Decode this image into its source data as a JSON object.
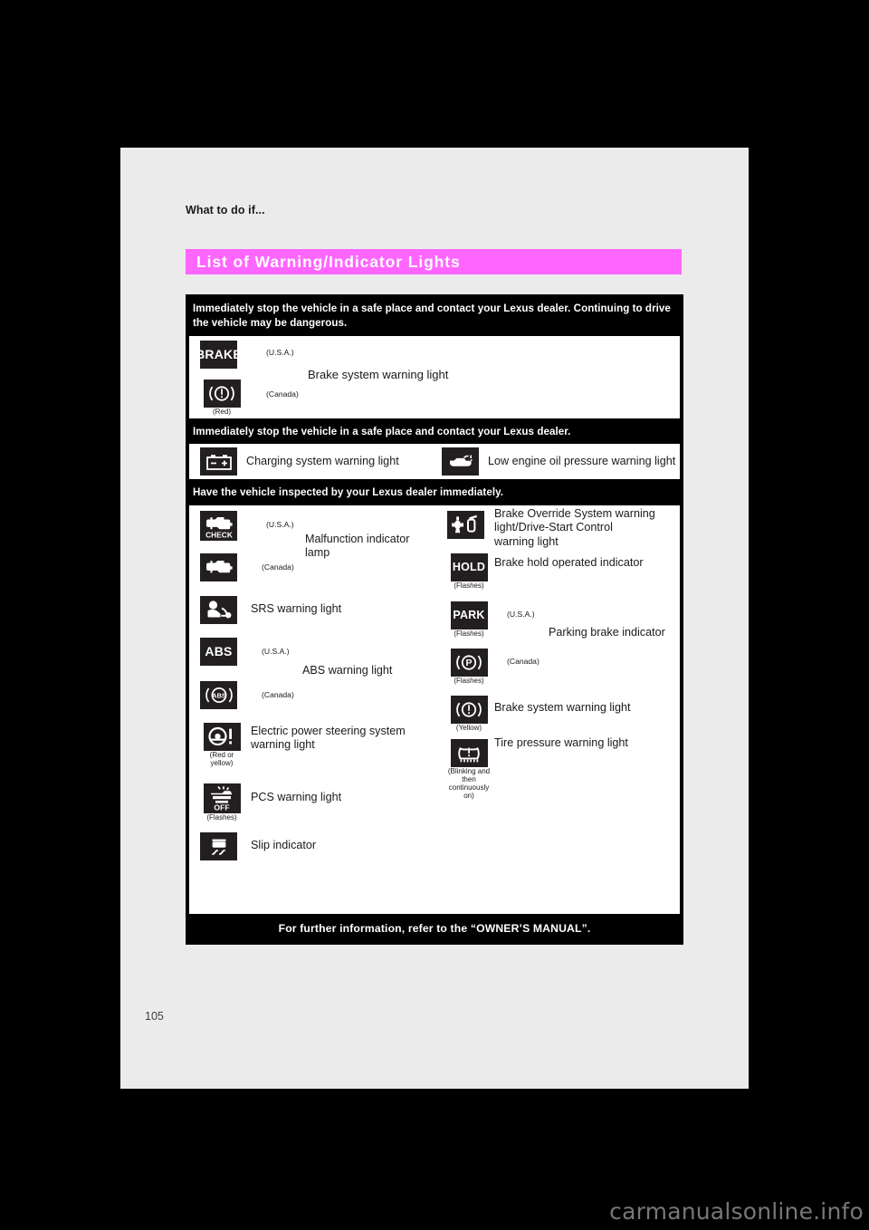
{
  "page": {
    "running_head": "What to do if...",
    "section_title": "List of Warning/Indicator Lights",
    "folio": "105",
    "watermark": "carmanualsonline.info",
    "accent_color": "#ff66ff",
    "band_color": "#000000",
    "sheet_color": "#ebebeb",
    "icon_tile_color": "#231f20"
  },
  "table": {
    "sections": [
      {
        "heading": "Immediately stop the vehicle in a safe place and contact your Lexus dealer. Continuing to drive the vehicle may be dangerous.",
        "items": [
          {
            "name": "Brake system warning light",
            "variants": [
              {
                "icon": "brake-word-icon",
                "icon_text": "BRAKE",
                "region": "(U.S.A.)"
              },
              {
                "icon": "brake-circle-exclamation-icon",
                "icon_text": "",
                "region": "(Canada)",
                "note": "(Red)"
              }
            ]
          }
        ]
      },
      {
        "heading": "Immediately stop the vehicle in a safe place and contact your Lexus dealer.",
        "items": [
          {
            "name": "Charging system warning light",
            "icon": "battery-icon"
          },
          {
            "name": "Low engine oil pressure warning light",
            "icon": "oil-can-icon"
          }
        ]
      },
      {
        "heading": "Have the vehicle inspected by your Lexus dealer immediately.",
        "left_items": [
          {
            "name": "Malfunction indicator lamp",
            "variants": [
              {
                "icon": "engine-check-icon",
                "icon_text": "CHECK",
                "region": "(U.S.A.)"
              },
              {
                "icon": "engine-icon",
                "icon_text": "",
                "region": "(Canada)"
              }
            ]
          },
          {
            "name": "SRS warning light",
            "icon": "srs-airbag-icon"
          },
          {
            "name": "ABS warning light",
            "variants": [
              {
                "icon": "abs-word-icon",
                "icon_text": "ABS",
                "region": "(U.S.A.)"
              },
              {
                "icon": "abs-circle-icon",
                "icon_text": "ABS",
                "region": "(Canada)"
              }
            ]
          },
          {
            "name": "Electric power steering system warning light",
            "icon": "steering-wheel-exclamation-icon",
            "note": "(Red or yellow)"
          },
          {
            "name": "PCS warning light",
            "icon": "pcs-off-icon",
            "icon_text": "OFF",
            "note": "(Flashes)"
          },
          {
            "name": "Slip indicator",
            "icon": "slip-indicator-icon"
          }
        ],
        "right_items": [
          {
            "name": "Brake Override System warning light/Drive-Start Control warning light",
            "icon": "brake-override-pedal-icon"
          },
          {
            "name": "Brake hold operated indicator",
            "icon": "hold-word-icon",
            "icon_text": "HOLD",
            "note": "(Flashes)"
          },
          {
            "name": "Parking brake indicator",
            "variants": [
              {
                "icon": "park-word-icon",
                "icon_text": "PARK",
                "region": "(U.S.A.)",
                "note": "(Flashes)"
              },
              {
                "icon": "park-circle-p-icon",
                "icon_text": "P",
                "region": "(Canada)",
                "note": "(Flashes)"
              }
            ]
          },
          {
            "name": "Brake system warning light",
            "icon": "brake-circle-exclamation-icon",
            "note": "(Yellow)"
          },
          {
            "name": "Tire pressure warning light",
            "icon": "tire-pressure-icon",
            "note": "(Blinking and then continuously on)"
          }
        ]
      }
    ],
    "footer": "For further information, refer to the “OWNER’S MANUAL”."
  }
}
